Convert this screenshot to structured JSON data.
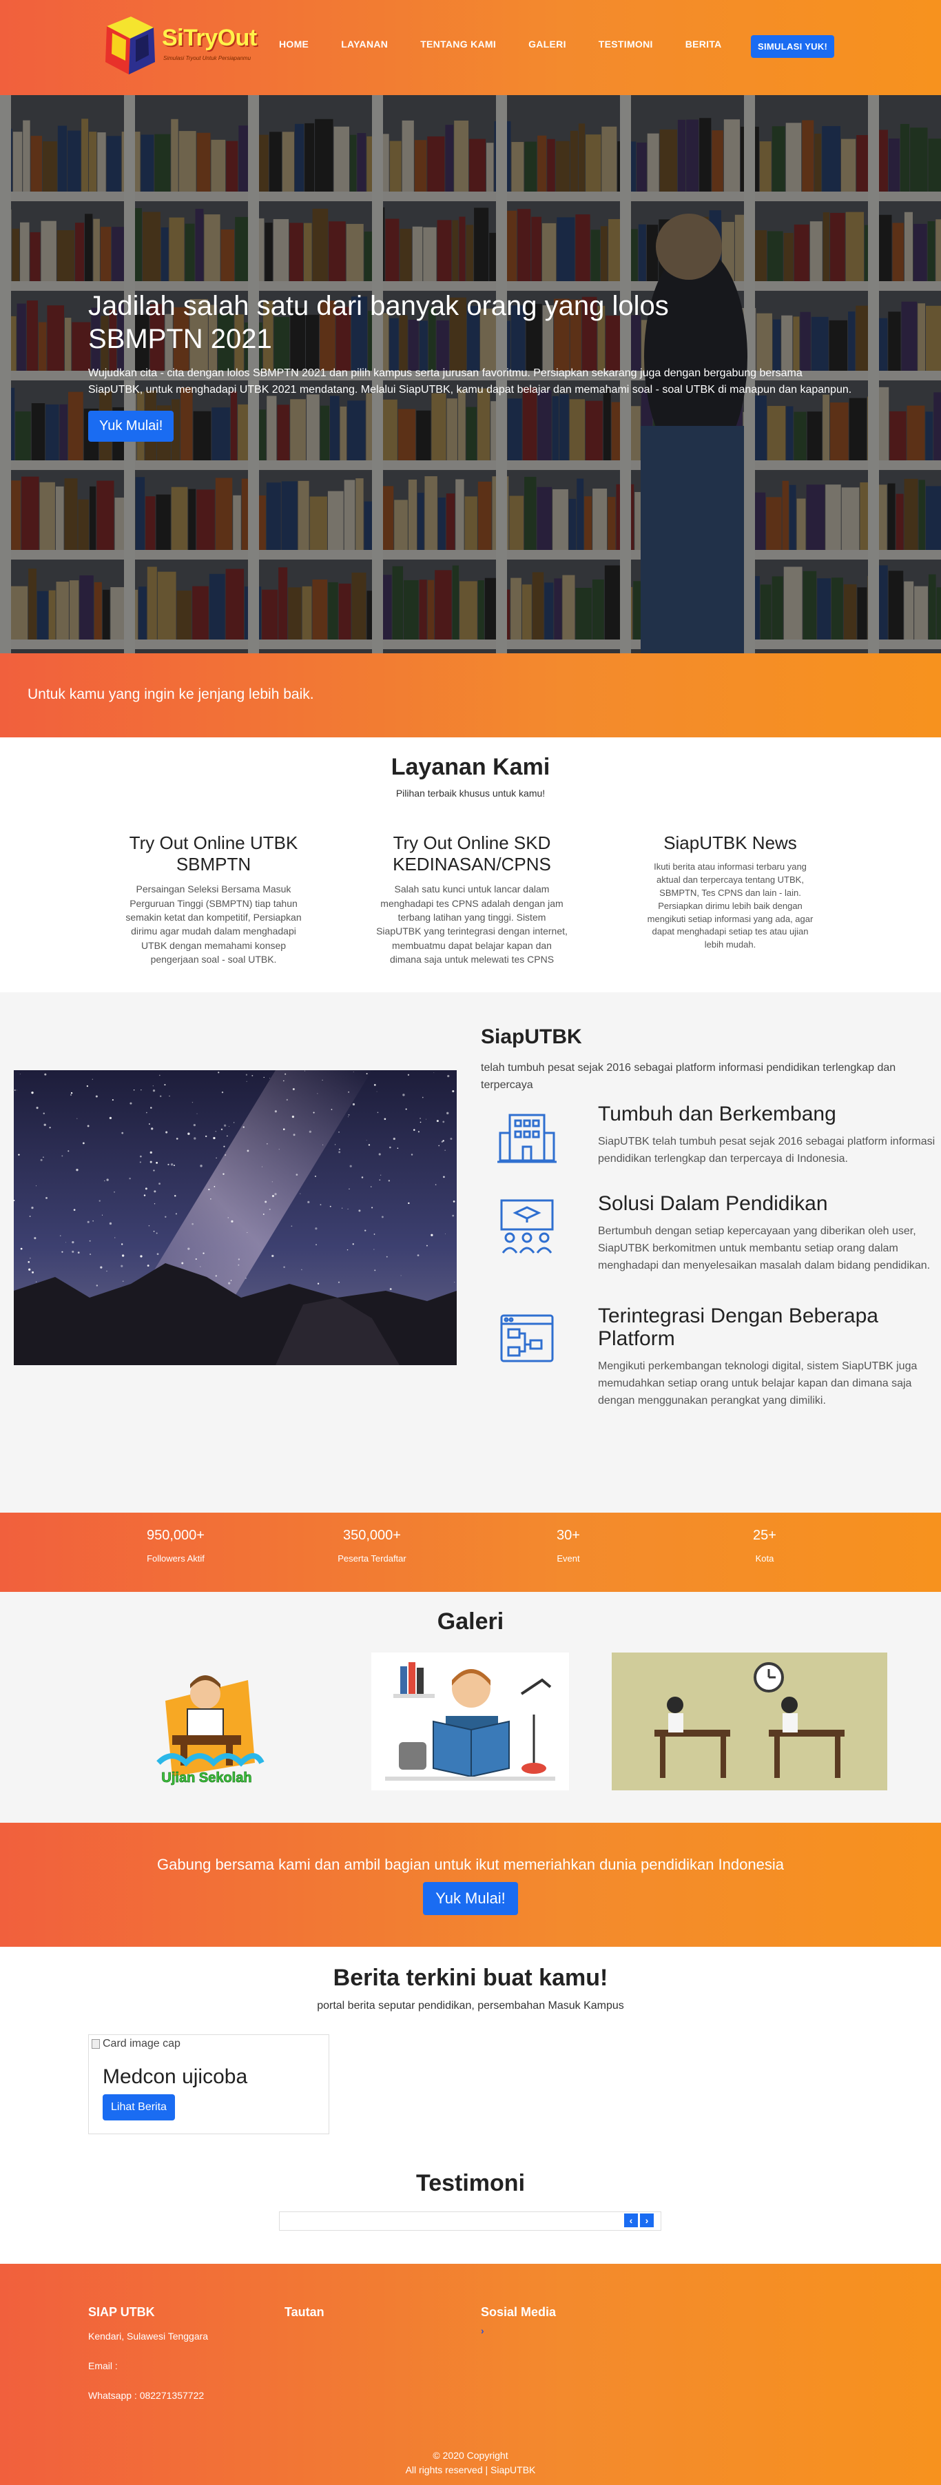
{
  "navbar": {
    "logo_text": "SiTryOut",
    "logo_tagline": "Simulasi Tryout Untuk Persiapanmu",
    "links": [
      "HOME",
      "LAYANAN",
      "TENTANG KAMI",
      "GALERI",
      "TESTIMONI",
      "BERITA"
    ],
    "cta": "SIMULASI YUK!"
  },
  "hero": {
    "title": "Jadilah salah satu dari banyak orang yang lolos SBMPTN 2021",
    "description": "Wujudkan cita - cita dengan lolos SBMPTN 2021 dan pilih kampus serta jurusan favoritmu. Persiapkan sekarang juga dengan bergabung bersama SiapUTBK, untuk menghadapi UTBK 2021 mendatang. Melalui SiapUTBK, kamu dapat belajar dan memahami soal - soal UTBK di manapun dan kapanpun.",
    "button": "Yuk Mulai!"
  },
  "banner": {
    "text": "Untuk kamu yang ingin ke jenjang lebih baik."
  },
  "layanan": {
    "title": "Layanan Kami",
    "subtitle": "Pilihan terbaik khusus untuk kamu!",
    "items": [
      {
        "title": "Try Out Online UTBK SBMPTN",
        "desc": "Persaingan Seleksi Bersama Masuk Perguruan Tinggi (SBMPTN) tiap tahun semakin ketat dan kompetitif, Persiapkan dirimu agar mudah dalam menghadapi UTBK dengan memahami konsep pengerjaan soal - soal UTBK."
      },
      {
        "title": "Try Out Online SKD KEDINASAN/CPNS",
        "desc": "Salah satu kunci untuk lancar dalam menghadapi tes CPNS adalah dengan jam terbang latihan yang tinggi. Sistem SiapUTBK yang terintegrasi dengan internet, membuatmu dapat belajar kapan dan dimana saja untuk melewati tes CPNS"
      },
      {
        "title": "SiapUTBK News",
        "desc": "Ikuti berita atau informasi terbaru yang aktual dan terpercaya tentang UTBK, SBMPTN, Tes CPNS dan lain - lain. Persiapkan dirimu lebih baik dengan mengikuti setiap informasi yang ada, agar dapat menghadapi setiap tes atau ujian lebih mudah."
      }
    ]
  },
  "about": {
    "title": "SiapUTBK",
    "desc": "telah tumbuh pesat sejak 2016 sebagai platform informasi pendidikan terlengkap dan terpercaya",
    "features": [
      {
        "icon": "building-icon",
        "title": "Tumbuh dan Berkembang",
        "desc": "SiapUTBK telah tumbuh pesat sejak 2016 sebagai platform informasi pendidikan terlengkap dan terpercaya di Indonesia."
      },
      {
        "icon": "classroom-icon",
        "title": "Solusi Dalam Pendidikan",
        "desc": "Bertumbuh dengan setiap kepercayaan yang diberikan oleh user, SiapUTBK berkomitmen untuk membantu setiap orang dalam menghadapi dan menyelesaikan masalah dalam bidang pendidikan."
      },
      {
        "icon": "platform-icon",
        "title": "Terintegrasi Dengan Beberapa Platform",
        "desc": "Mengikuti perkembangan teknologi digital, sistem SiapUTBK juga memudahkan setiap orang untuk belajar kapan dan dimana saja dengan menggunakan perangkat yang dimiliki."
      }
    ]
  },
  "stats": [
    {
      "value": "950,000+",
      "label": "Followers Aktif"
    },
    {
      "value": "350,000+",
      "label": "Peserta Terdaftar"
    },
    {
      "value": "30+",
      "label": "Event"
    },
    {
      "value": "25+",
      "label": "Kota"
    }
  ],
  "galeri": {
    "title": "Galeri",
    "image1_caption": "Ujian Sekolah"
  },
  "cta": {
    "text": "Gabung bersama kami dan ambil bagian untuk ikut memeriahkan dunia pendidikan Indonesia",
    "button": "Yuk Mulai!"
  },
  "berita": {
    "title": "Berita terkini buat kamu!",
    "subtitle": "portal berita seputar pendidikan, persembahan Masuk Kampus",
    "card": {
      "image_alt": "Card image cap",
      "title": "Medcon ujicoba",
      "button": "Lihat Berita"
    }
  },
  "testimoni": {
    "title": "Testimoni",
    "prev": "‹",
    "next": "›"
  },
  "footer": {
    "col1": {
      "title": "SIAP UTBK",
      "location": "Kendari, Sulawesi Tenggara",
      "email": "Email :",
      "whatsapp": "Whatsapp : 082271357722"
    },
    "col2": {
      "title": "Tautan"
    },
    "col3": {
      "title": "Sosial Media",
      "link": "›"
    },
    "copyright": "© 2020 Copyright",
    "rights": "All rights reserved | SiapUTBK"
  },
  "colors": {
    "orange_start": "#f1603d",
    "orange_end": "#f7921e",
    "primary_blue": "#1a6cf2"
  }
}
